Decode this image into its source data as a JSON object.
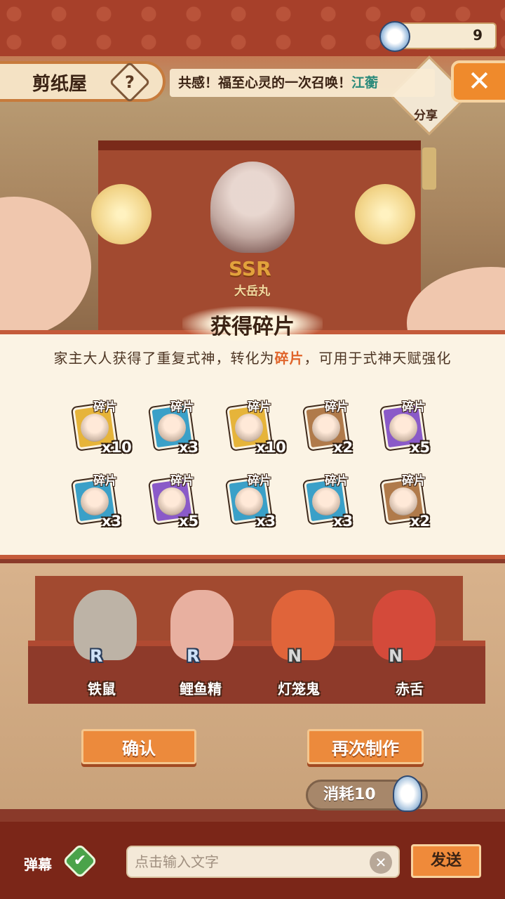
{
  "header": {
    "title": "剪纸屋",
    "help_icon": "?",
    "marquee_prefix": "共感！福至心灵的一次召唤！",
    "marquee_highlight": "江蘅",
    "close_icon": "✕",
    "share_label": "分享"
  },
  "currency": {
    "icon": "paper-doll-icon",
    "value": "9"
  },
  "banner": {
    "rarity": "SSR",
    "name": "大岳丸"
  },
  "result_panel": {
    "title": "获得碎片",
    "desc_prefix": "家主大人获得了重复式神，转化为",
    "desc_highlight": "碎片",
    "desc_suffix": "，可用于式神天赋强化",
    "fragments": [
      {
        "tag": "碎片",
        "count": "x10",
        "color": "#e6b43a"
      },
      {
        "tag": "碎片",
        "count": "x3",
        "color": "#3aa0c8"
      },
      {
        "tag": "碎片",
        "count": "x10",
        "color": "#e6b43a"
      },
      {
        "tag": "碎片",
        "count": "x2",
        "color": "#b07a4a"
      },
      {
        "tag": "碎片",
        "count": "x5",
        "color": "#8a5ac8"
      },
      {
        "tag": "碎片",
        "count": "x3",
        "color": "#3aa0c8"
      },
      {
        "tag": "碎片",
        "count": "x5",
        "color": "#8a5ac8"
      },
      {
        "tag": "碎片",
        "count": "x3",
        "color": "#3aa0c8"
      },
      {
        "tag": "碎片",
        "count": "x3",
        "color": "#3aa0c8"
      },
      {
        "tag": "碎片",
        "count": "x2",
        "color": "#b07a4a"
      }
    ]
  },
  "characters": [
    {
      "name": "铁鼠",
      "rank": "R",
      "color": "#bdb3a6"
    },
    {
      "name": "鲤鱼精",
      "rank": "R",
      "color": "#e8b0a0"
    },
    {
      "name": "灯笼鬼",
      "rank": "N",
      "color": "#e0643a"
    },
    {
      "name": "赤舌",
      "rank": "N",
      "color": "#d44a3a"
    }
  ],
  "buttons": {
    "confirm": "确认",
    "again": "再次制作",
    "cost": "消耗10"
  },
  "footer": {
    "danmaku_label": "弹幕",
    "danmaku_check": "✔",
    "input_placeholder": "点击输入文字",
    "clear_icon": "✕",
    "send": "发送"
  }
}
